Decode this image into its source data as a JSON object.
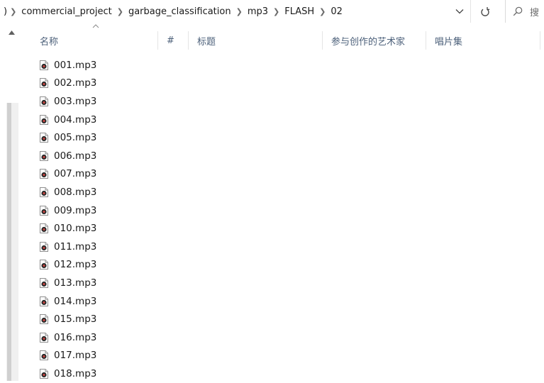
{
  "address_bar": {
    "breadcrumb": [
      ")",
      "commercial_project",
      "garbage_classification",
      "mp3",
      "FLASH",
      "02"
    ],
    "search_placeholder": "搜"
  },
  "columns": {
    "name": "名称",
    "number": "#",
    "title": "标题",
    "artist": "参与创作的艺术家",
    "album": "唱片集"
  },
  "files": [
    "001.mp3",
    "002.mp3",
    "003.mp3",
    "004.mp3",
    "005.mp3",
    "006.mp3",
    "007.mp3",
    "008.mp3",
    "009.mp3",
    "010.mp3",
    "011.mp3",
    "012.mp3",
    "013.mp3",
    "014.mp3",
    "015.mp3",
    "016.mp3",
    "017.mp3",
    "018.mp3"
  ],
  "icons": {
    "file_icon": "audio-file-icon",
    "dropdown": "chevron-down-icon",
    "refresh": "refresh-icon",
    "search": "search-icon",
    "scroll_up": "scroll-up-arrow-icon",
    "sort": "sort-ascending-icon"
  },
  "colors": {
    "header_text": "#4c607a",
    "file_icon_accent": "#c0392b"
  }
}
